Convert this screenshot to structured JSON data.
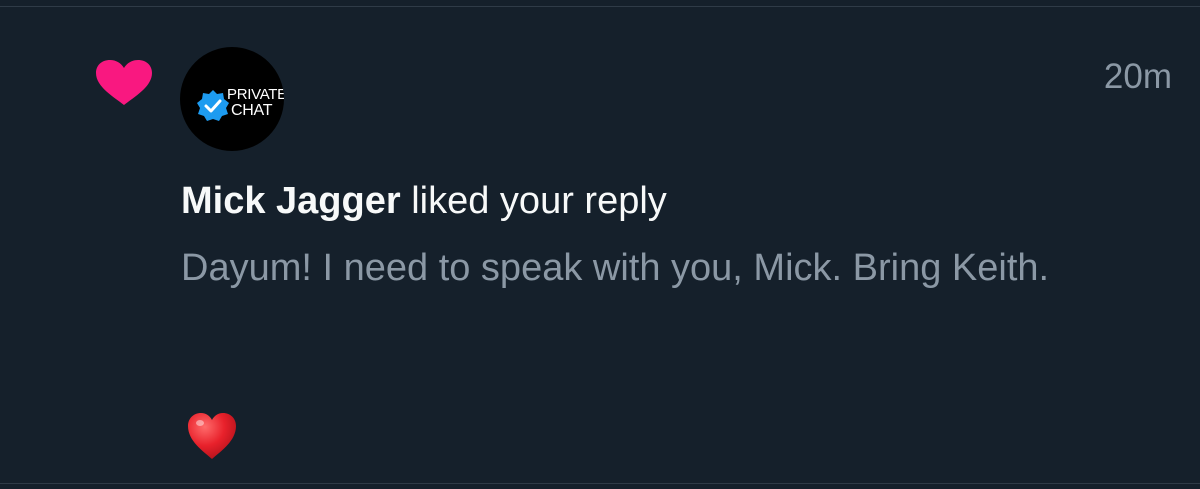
{
  "notification": {
    "type_icon": "heart-icon",
    "type_icon_color": "#f91880",
    "avatar": {
      "badge_icon": "verified-badge-icon",
      "badge_color": "#1d9bf0",
      "brand_line1": "PRIVATE",
      "brand_line2": "CHAT"
    },
    "timestamp": "20m",
    "user_name": "Mick Jagger",
    "action_text": "liked your reply",
    "reply_text": "Dayum! I need to speak with you, Mick. Bring Keith.",
    "emoji": "red-heart-emoji",
    "emoji_color": "#e8212b"
  },
  "theme": {
    "background": "#15202b",
    "primary_text": "#f7f9f9",
    "secondary_text": "#8b98a5",
    "divider": "#2f3b47"
  }
}
